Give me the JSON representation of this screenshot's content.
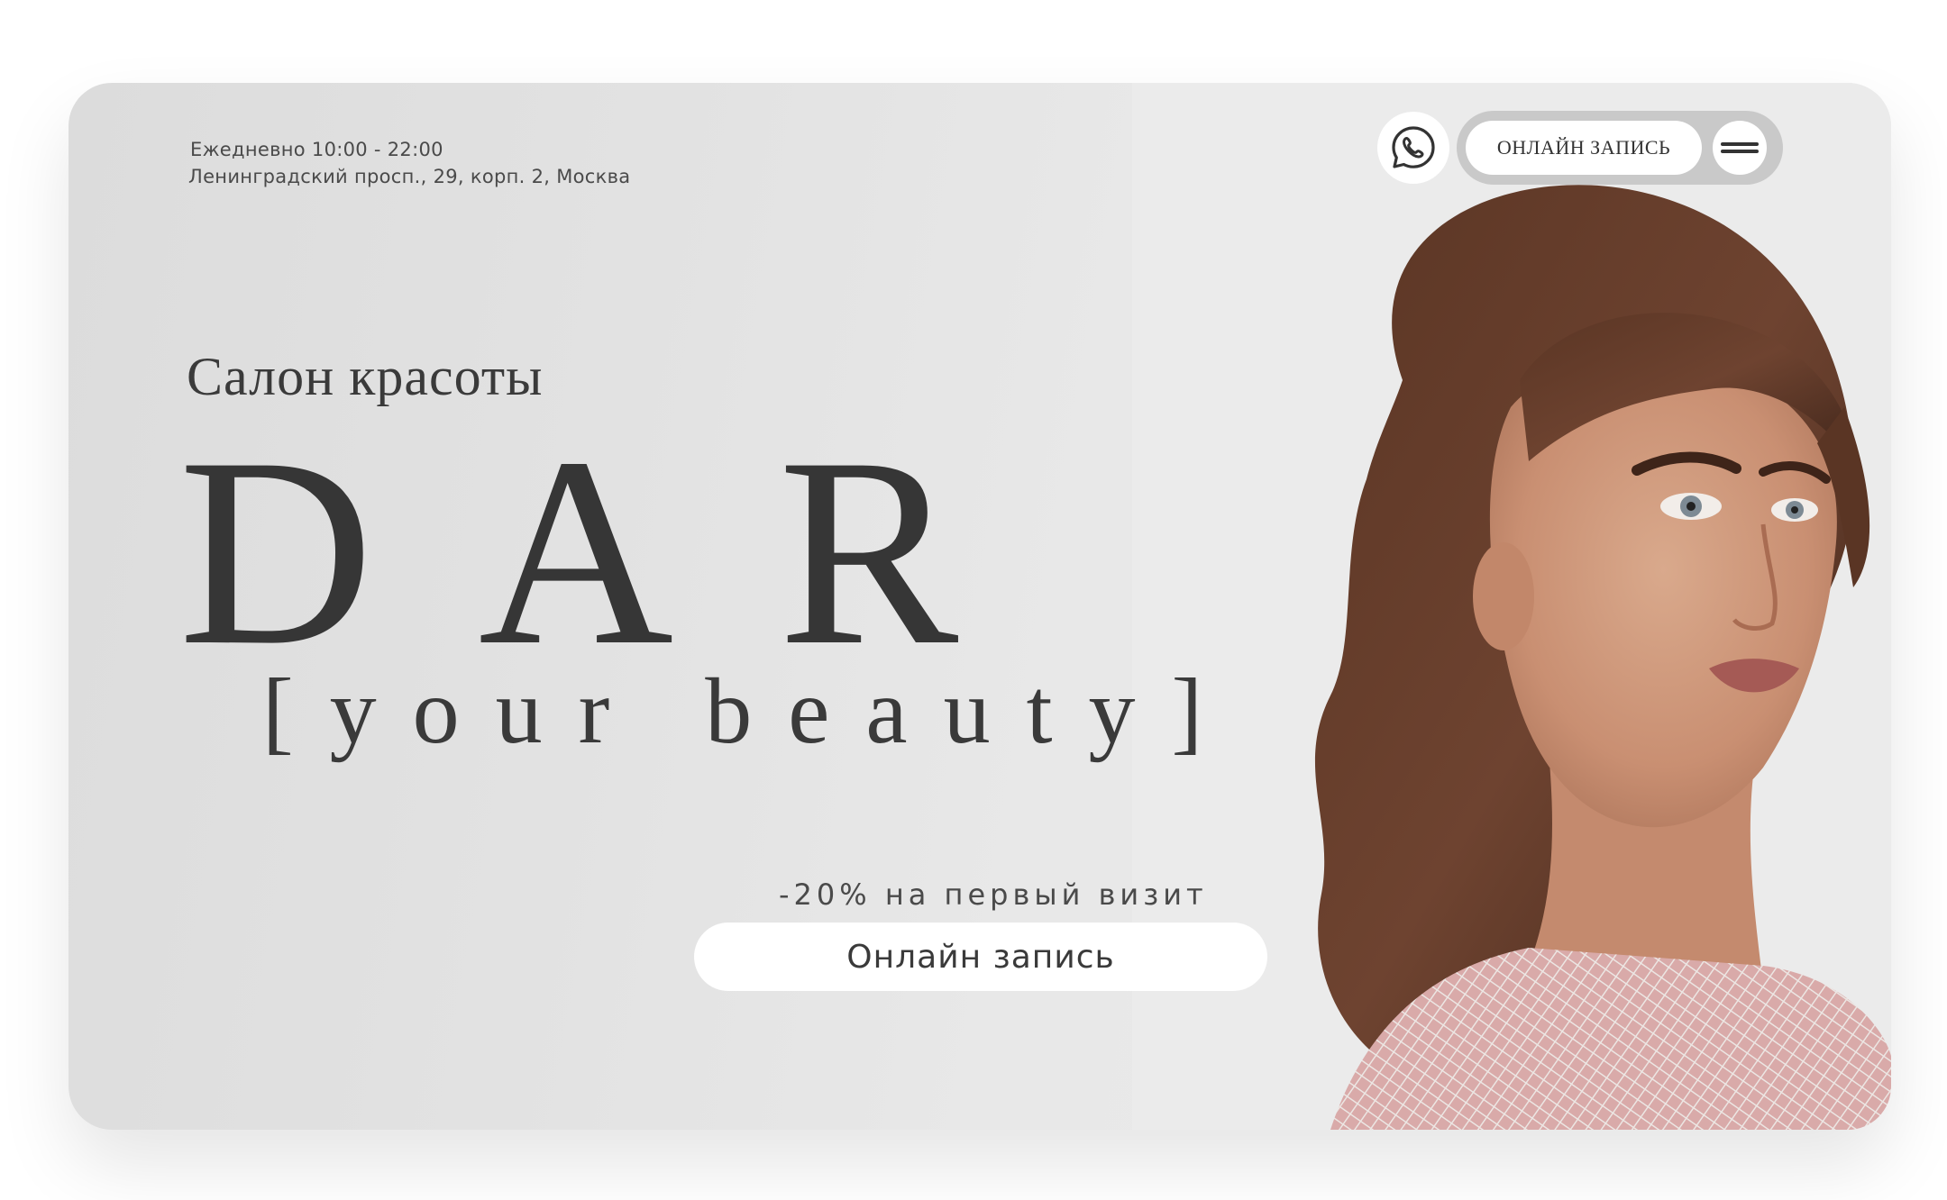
{
  "header": {
    "hours": "Ежедневно 10:00 - 22:00",
    "address": "Ленинградский просп., 29, корп. 2, Москва",
    "whatsapp_icon": "whatsapp-icon",
    "book_button_label": "ОНЛАЙН ЗАПИСЬ",
    "menu_icon": "hamburger-menu-icon"
  },
  "hero": {
    "subtitle": "Салон красоты",
    "brand": "DAR",
    "tagline": "[your beauty]",
    "promo": "-20% на первый визит",
    "cta_label": "Онлайн запись",
    "photo": "portrait-photo"
  },
  "colors": {
    "background": "#e4e4e4",
    "text_dark": "#363636",
    "button_bg": "#ffffff",
    "pill_bg": "#c9c9c9"
  }
}
